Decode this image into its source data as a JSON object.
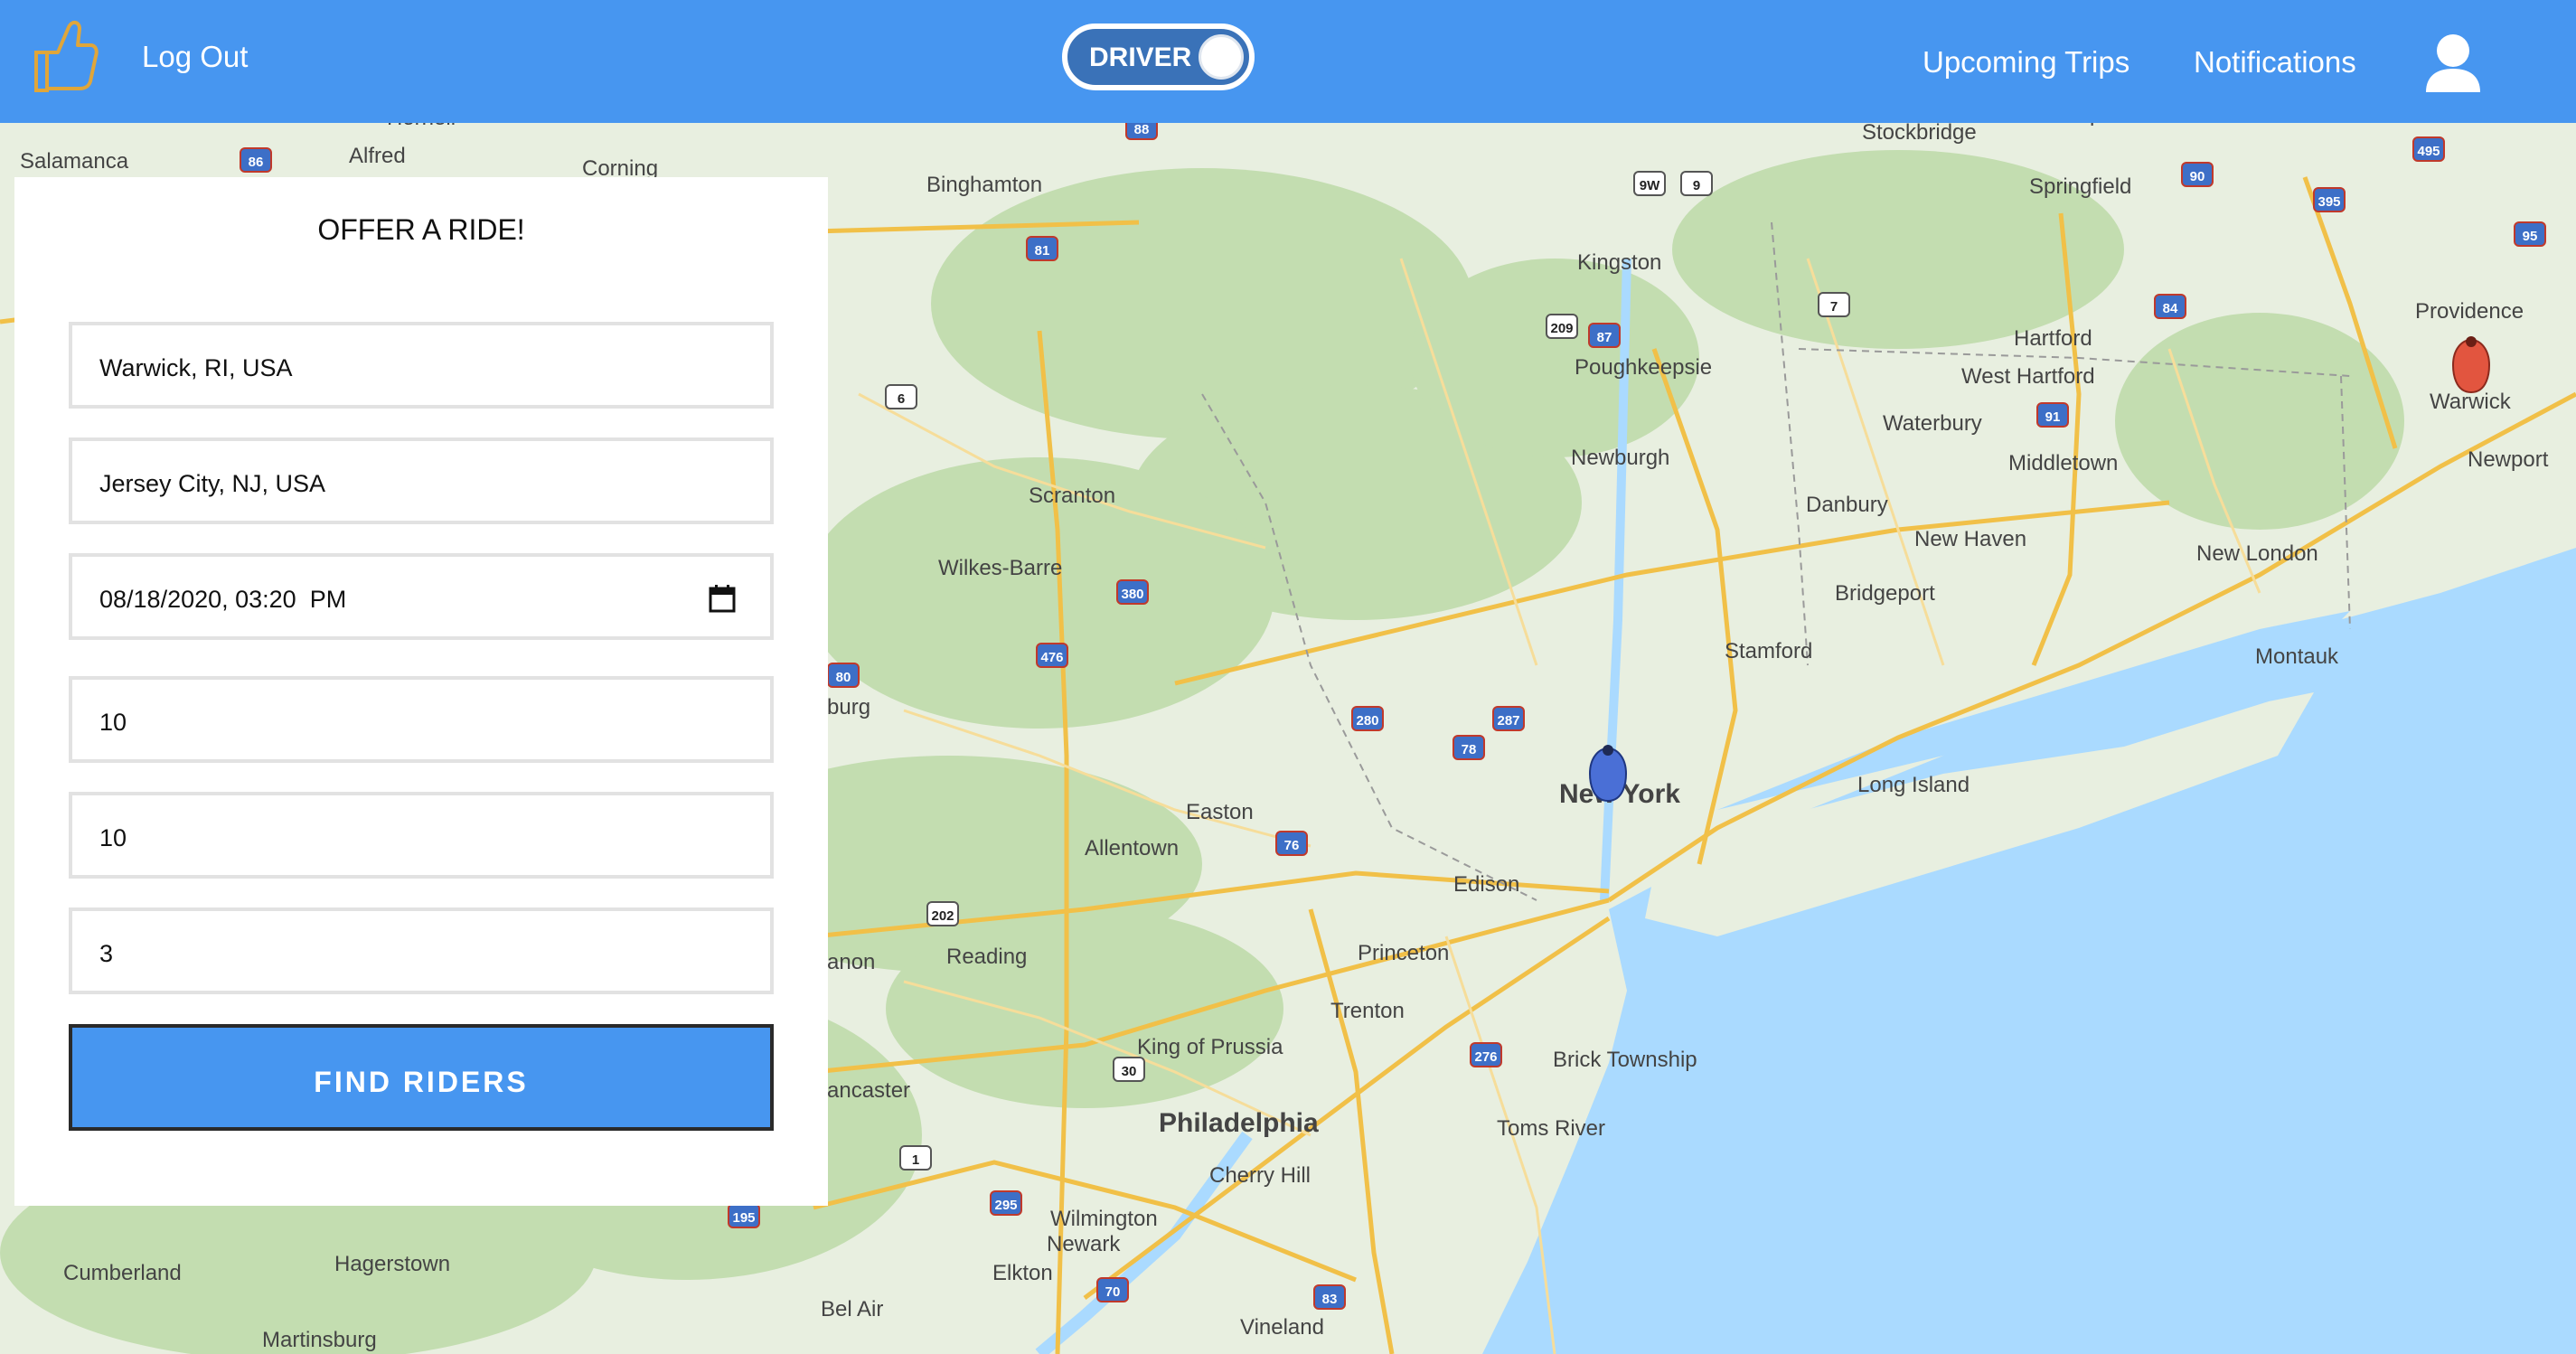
{
  "header": {
    "logout_label": "Log Out",
    "mode_toggle_label": "DRIVER",
    "upcoming_trips_label": "Upcoming Trips",
    "notifications_label": "Notifications"
  },
  "form": {
    "title": "OFFER A RIDE!",
    "origin": "Warwick, RI, USA",
    "destination": "Jersey City, NJ, USA",
    "datetime": "08/18/2020, 03:20  PM",
    "field4": "10",
    "field5": "10",
    "field6": "3",
    "submit_label": "FIND RIDERS"
  },
  "map": {
    "cities": [
      "Binghamton",
      "Stockbridge",
      "Springfield",
      "Northampton",
      "Kingston",
      "Poughkeepsie",
      "Hartford",
      "West Hartford",
      "Providence",
      "Warwick",
      "Newport",
      "Waterbury",
      "Middletown",
      "Newburgh",
      "Scranton",
      "Wilkes-Barre",
      "Danbury",
      "New Haven",
      "New London",
      "Bridgeport",
      "Stamford",
      "Montauk",
      "Long Island",
      "New York",
      "Easton",
      "Allentown",
      "Edison",
      "Reading",
      "Princeton",
      "Trenton",
      "King of Prussia",
      "Brick Township",
      "Philadelphia",
      "Cherry Hill",
      "Toms River",
      "Wilmington",
      "Newark",
      "Elkton",
      "Vineland",
      "Hagerstown",
      "Cumberland",
      "Bel Air",
      "Martinsburg",
      "Salamanca",
      "Alfred",
      "Corning",
      "Hornell",
      "ancaster",
      "anon",
      "burg"
    ],
    "highways": [
      "86",
      "88",
      "9W",
      "9",
      "90",
      "495",
      "395",
      "95",
      "81",
      "209",
      "87",
      "7",
      "84",
      "91",
      "6",
      "380",
      "476",
      "280",
      "80",
      "287",
      "78",
      "76",
      "202",
      "30",
      "1",
      "295",
      "70",
      "83",
      "195",
      "276"
    ],
    "markers": {
      "origin_color": "#e2553f",
      "destination_color": "#4a6fd6"
    },
    "colors": {
      "water": "#aadaff",
      "land": "#e8efe0",
      "forest": "#c3ddb0",
      "road": "#f4d27a",
      "highway": "#f1c048"
    }
  }
}
